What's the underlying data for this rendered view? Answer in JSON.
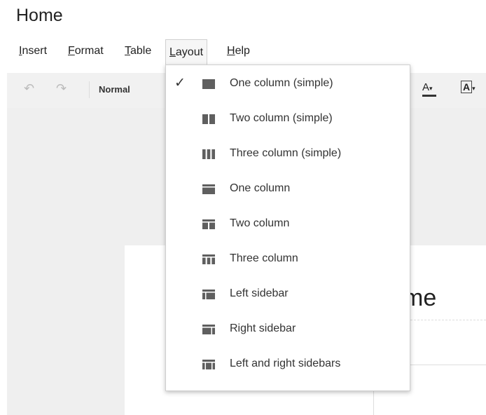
{
  "page_title": "Home",
  "menu": {
    "insert": {
      "accel": "I",
      "rest": "nsert"
    },
    "format": {
      "accel": "F",
      "rest": "ormat"
    },
    "table": {
      "accel": "T",
      "rest": "able"
    },
    "layout": {
      "accel": "L",
      "rest": "ayout"
    },
    "help": {
      "accel": "H",
      "rest": "elp"
    }
  },
  "toolbar": {
    "undo_icon": "undo-icon",
    "redo_icon": "redo-icon",
    "style_value": "Normal",
    "font_color_label": "A",
    "highlight_label": "A"
  },
  "document": {
    "heading_fragment": "me"
  },
  "layout_menu": {
    "selected_index": 0,
    "items": [
      {
        "label": "One column (simple)",
        "icon": "one-column-simple-icon",
        "checked": true
      },
      {
        "label": "Two column (simple)",
        "icon": "two-column-simple-icon",
        "checked": false
      },
      {
        "label": "Three column (simple)",
        "icon": "three-column-simple-icon",
        "checked": false
      },
      {
        "label": "One column",
        "icon": "one-column-icon",
        "checked": false
      },
      {
        "label": "Two column",
        "icon": "two-column-icon",
        "checked": false
      },
      {
        "label": "Three column",
        "icon": "three-column-icon",
        "checked": false
      },
      {
        "label": "Left sidebar",
        "icon": "left-sidebar-icon",
        "checked": false
      },
      {
        "label": "Right sidebar",
        "icon": "right-sidebar-icon",
        "checked": false
      },
      {
        "label": "Left and right sidebars",
        "icon": "left-right-sidebars-icon",
        "checked": false
      }
    ]
  },
  "colors": {
    "icon_fill": "#5f5f5f",
    "menu_text": "#333333",
    "toolbar_bg": "#f1f1f1",
    "canvas_bg": "#efefef"
  }
}
